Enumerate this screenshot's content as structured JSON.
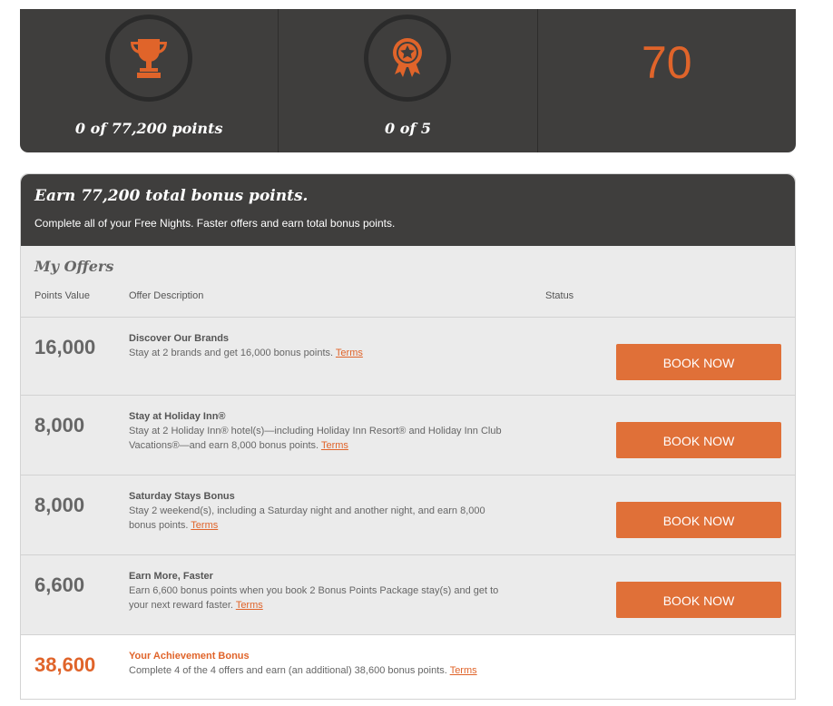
{
  "stats": {
    "points_progress": "0 of 77,200 points",
    "offers_progress": "0 of 5",
    "big_number": "70",
    "icons": [
      "trophy-icon",
      "award-ribbon-icon"
    ],
    "accent_color": "#e0642a"
  },
  "header": {
    "title": "Earn 77,200 total bonus points.",
    "subtitle": "Complete all of your Free Nights. Faster offers and earn total bonus points."
  },
  "section": {
    "title": "My Offers",
    "columns": [
      "Points Value",
      "Offer Description",
      "Status"
    ]
  },
  "offers": [
    {
      "points": "16,000",
      "title": "Discover Our Brands",
      "desc": "Stay at 2 brands and get 16,000 bonus points.",
      "terms": "Terms",
      "button": "BOOK NOW"
    },
    {
      "points": "8,000",
      "title": "Stay at Holiday Inn®",
      "desc": "Stay at 2 Holiday Inn® hotel(s)—including Holiday Inn Resort® and Holiday Inn Club Vacations®—and earn 8,000 bonus points.",
      "terms": "Terms",
      "button": "BOOK NOW"
    },
    {
      "points": "8,000",
      "title": "Saturday Stays Bonus",
      "desc": "Stay 2 weekend(s), including a Saturday night and another night, and earn 8,000 bonus points.",
      "terms": "Terms",
      "button": "BOOK NOW"
    },
    {
      "points": "6,600",
      "title": "Earn More, Faster",
      "desc": "Earn 6,600 bonus points when you book 2 Bonus Points Package stay(s) and get to your next reward faster.",
      "terms": "Terms",
      "button": "BOOK NOW"
    }
  ],
  "achievement": {
    "points": "38,600",
    "title": "Your Achievement Bonus",
    "desc": "Complete 4 of the 4 offers and earn (an additional) 38,600 bonus points.",
    "terms": "Terms"
  }
}
